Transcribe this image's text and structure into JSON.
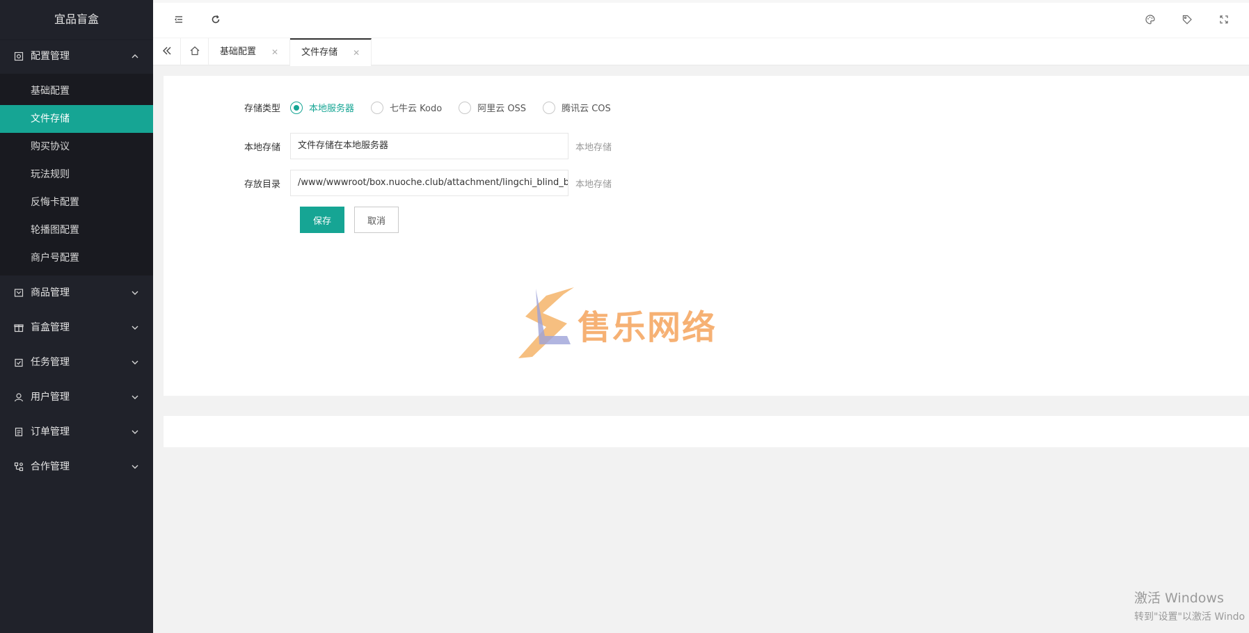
{
  "app": {
    "title": "宜品盲盒"
  },
  "sidebar": {
    "groups": [
      {
        "label": "配置管理",
        "icon": "settings-icon",
        "expanded": true,
        "items": [
          "基础配置",
          "文件存储",
          "购买协议",
          "玩法规则",
          "反悔卡配置",
          "轮播图配置",
          "商户号配置"
        ],
        "active_item": "文件存储"
      },
      {
        "label": "商品管理",
        "icon": "product-icon",
        "expanded": false
      },
      {
        "label": "盲盒管理",
        "icon": "gift-icon",
        "expanded": false
      },
      {
        "label": "任务管理",
        "icon": "task-icon",
        "expanded": false
      },
      {
        "label": "用户管理",
        "icon": "user-icon",
        "expanded": false
      },
      {
        "label": "订单管理",
        "icon": "order-icon",
        "expanded": false
      },
      {
        "label": "合作管理",
        "icon": "cooperation-icon",
        "expanded": false
      }
    ]
  },
  "header": {
    "left_icons": [
      "menu-fold-icon",
      "refresh-icon"
    ],
    "right_icons": [
      "theme-icon",
      "tag-icon",
      "fullscreen-icon"
    ]
  },
  "tabs": {
    "items": [
      {
        "label": "基础配置",
        "active": false
      },
      {
        "label": "文件存储",
        "active": true
      }
    ]
  },
  "form": {
    "storage_type": {
      "label": "存储类型",
      "options": [
        "本地服务器",
        "七牛云 Kodo",
        "阿里云 OSS",
        "腾讯云 COS"
      ],
      "selected": "本地服务器"
    },
    "local_storage": {
      "label": "本地存储",
      "value": "文件存储在本地服务器",
      "aux": "本地存储"
    },
    "directory": {
      "label": "存放目录",
      "value": "/www/wwwroot/box.nuoche.club/attachment/lingchi_blind_box/",
      "aux": "本地存储"
    },
    "save_label": "保存",
    "cancel_label": "取消"
  },
  "watermark": {
    "text": "售乐网络"
  },
  "windows_activation": {
    "line1": "激活 Windows",
    "line2": "转到\"设置\"以激活 Windo"
  },
  "colors": {
    "accent": "#16a594",
    "sidebar_bg": "#20222a",
    "submenu_bg": "#191a20"
  }
}
